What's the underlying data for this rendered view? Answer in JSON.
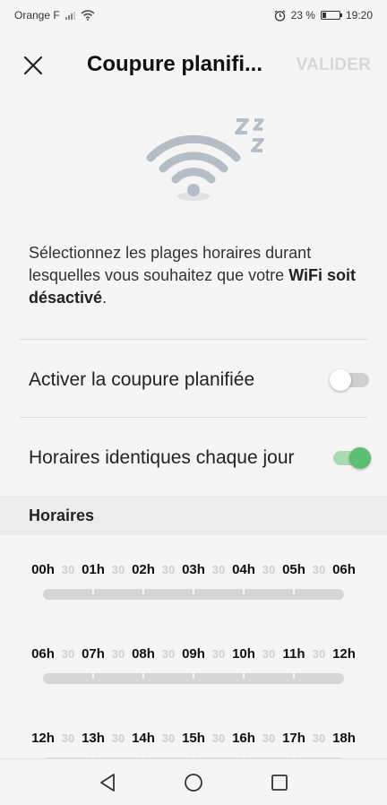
{
  "status_bar": {
    "carrier": "Orange F",
    "battery_percent": "23 %",
    "time": "19:20",
    "battery_level": 0.23,
    "icons": [
      "signal-icon",
      "wifi-icon",
      "alarm-icon",
      "battery-icon"
    ]
  },
  "header": {
    "title": "Coupure planifi...",
    "validate_label": "VALIDER",
    "close_icon": "close-icon"
  },
  "illustration": {
    "icon": "wifi-sleep-icon",
    "accent": "#b5bec6"
  },
  "description": {
    "text_before": "Sélectionnez les plages horaires durant lesquelles vous souhaitez que votre ",
    "bold": "WiFi soit désactivé",
    "text_after": "."
  },
  "settings": [
    {
      "label": "Activer la coupure planifiée",
      "enabled": false
    },
    {
      "label": "Horaires identiques chaque jour",
      "enabled": true
    }
  ],
  "schedule": {
    "section_title": "Horaires",
    "blocks": [
      {
        "hours": [
          "00h",
          "01h",
          "02h",
          "03h",
          "04h",
          "05h",
          "06h"
        ],
        "halves": [
          "30",
          "30",
          "30",
          "30",
          "30",
          "30"
        ]
      },
      {
        "hours": [
          "06h",
          "07h",
          "08h",
          "09h",
          "10h",
          "11h",
          "12h"
        ],
        "halves": [
          "30",
          "30",
          "30",
          "30",
          "30",
          "30"
        ]
      },
      {
        "hours": [
          "12h",
          "13h",
          "14h",
          "15h",
          "16h",
          "17h",
          "18h"
        ],
        "halves": [
          "30",
          "30",
          "30",
          "30",
          "30",
          "30"
        ]
      }
    ]
  },
  "nav": {
    "back_icon": "back-triangle-icon",
    "home_icon": "home-circle-icon",
    "recents_icon": "recents-square-icon"
  },
  "colors": {
    "toggle_on": "#5cbf73",
    "toggle_on_track": "#a9dbb3",
    "toggle_off_track": "#cfcfcf",
    "validate_disabled": "#d8d8d8"
  }
}
